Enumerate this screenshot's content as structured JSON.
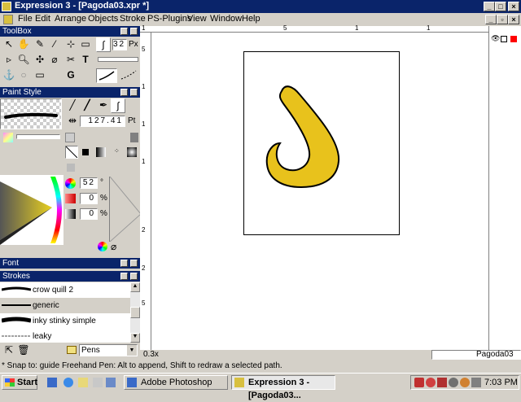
{
  "window": {
    "title": "Expression 3 - [Pagoda03.xpr *]"
  },
  "menu": [
    "File",
    "Edit",
    "Arrange",
    "Objects",
    "Stroke",
    "PS-Plugins",
    "View",
    "Window",
    "Help"
  ],
  "toolbox": {
    "title": "ToolBox",
    "brush_size": "32",
    "brush_unit": "Px"
  },
  "paint_style": {
    "title": "Paint Style",
    "width_value": "127.41",
    "width_unit": "Pt"
  },
  "color": {
    "hue": "52",
    "hue_unit": "°",
    "sat": "0",
    "sat_unit": "%",
    "bright": "0",
    "bright_unit": "%"
  },
  "font_panel": {
    "title": "Font"
  },
  "strokes_panel": {
    "title": "Strokes",
    "items": [
      "crow quill 2",
      "generic",
      "inky stinky simple",
      "leaky"
    ],
    "selected_index": 1,
    "category": "Pens"
  },
  "ruler": {
    "top_labels": [
      "1",
      "5",
      "1",
      "1"
    ],
    "left_labels": [
      "5",
      "1",
      "1",
      "1",
      "2",
      "2",
      "5"
    ]
  },
  "document": {
    "zoom": "0.3x",
    "name": "Pagoda03"
  },
  "status": {
    "message": "* Snap to: guide    Freehand Pen: Alt to append, Shift to redraw a selected path."
  },
  "taskbar": {
    "start": "Start",
    "tasks": [
      "Adobe Photoshop",
      "Expression 3 - [Pagoda03..."
    ],
    "active_task_index": 1,
    "clock": "7:03 PM"
  },
  "colors": {
    "shape_fill": "#e8c21c",
    "title_bar": "#0a246a",
    "face": "#d4d0c8"
  }
}
